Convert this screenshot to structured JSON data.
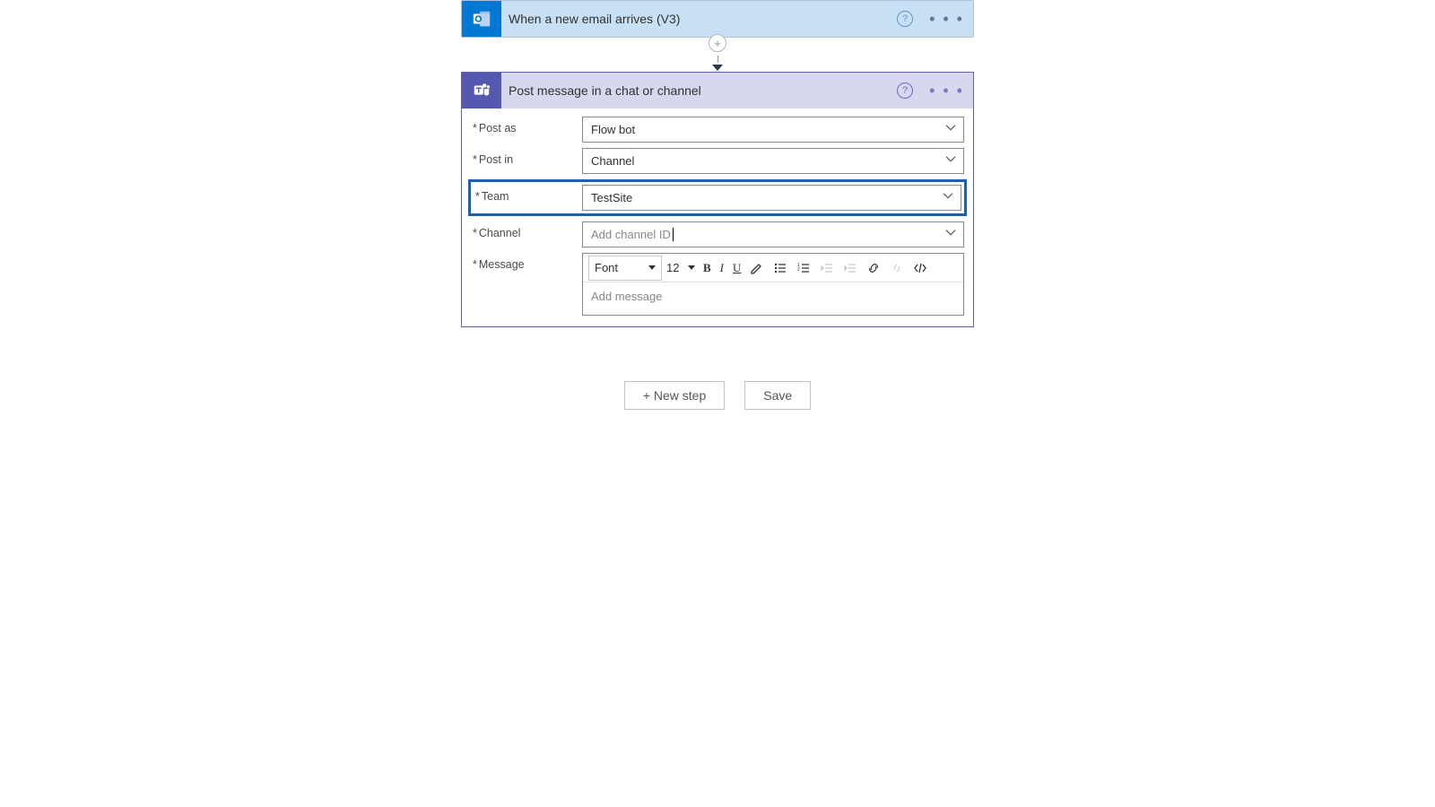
{
  "trigger": {
    "title": "When a new email arrives (V3)"
  },
  "action": {
    "title": "Post message in a chat or channel",
    "fields": {
      "post_as": {
        "label": "Post as",
        "value": "Flow bot"
      },
      "post_in": {
        "label": "Post in",
        "value": "Channel"
      },
      "team": {
        "label": "Team",
        "value": "TestSite"
      },
      "channel": {
        "label": "Channel",
        "placeholder": "Add channel ID"
      },
      "message": {
        "label": "Message",
        "placeholder": "Add message"
      }
    },
    "editor": {
      "font_label": "Font",
      "size": "12"
    }
  },
  "footer": {
    "new_step": "+ New step",
    "save": "Save"
  },
  "help_glyph": "?",
  "dots_glyph": "• • •"
}
